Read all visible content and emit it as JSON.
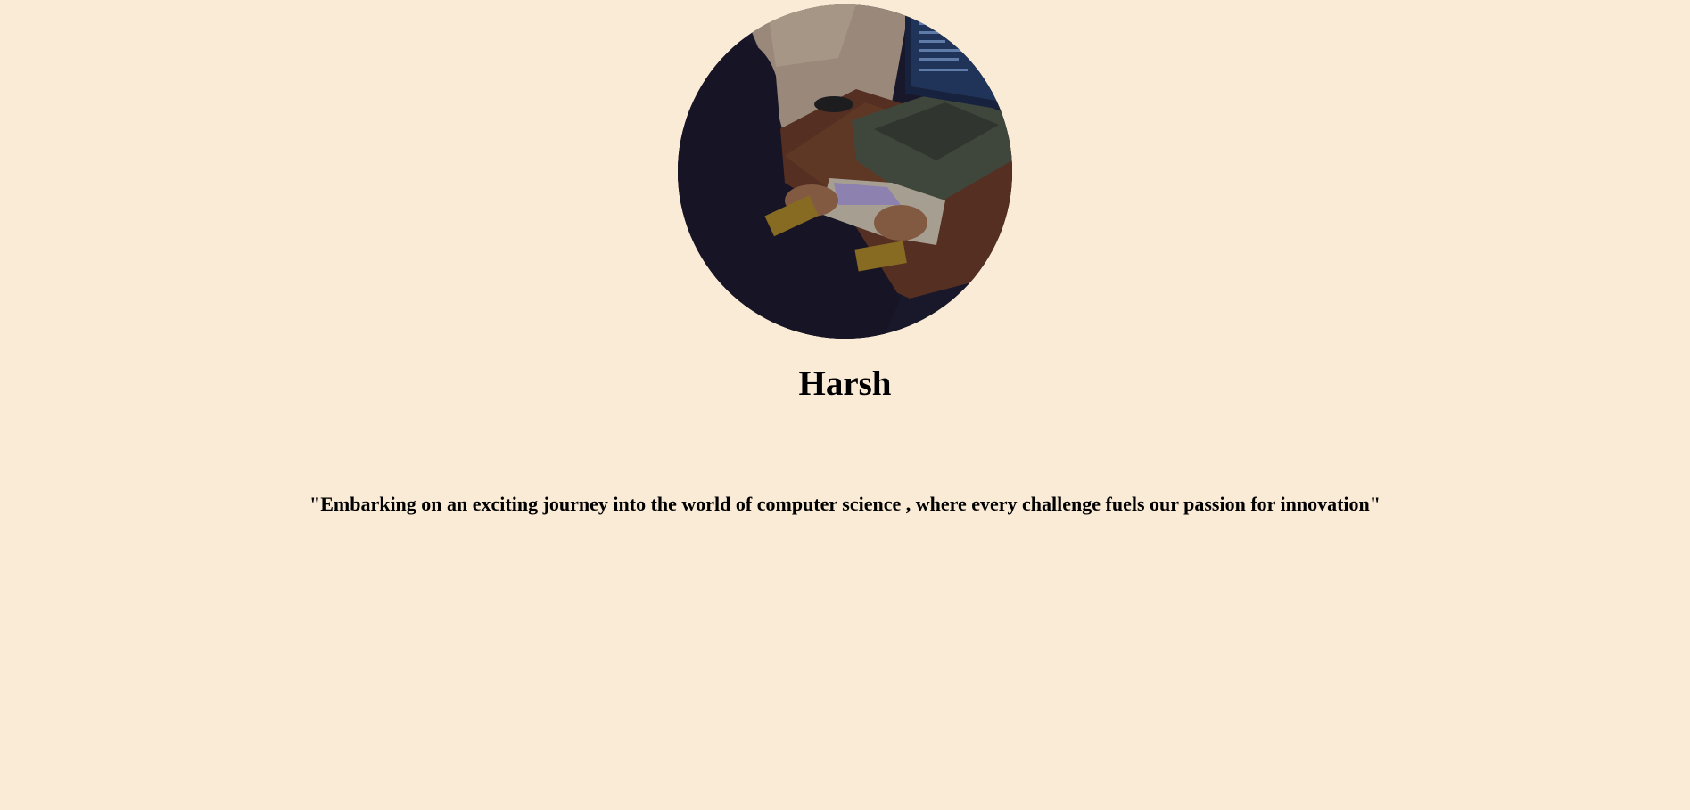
{
  "profile": {
    "photo_icon": "person-typing-on-keyboard-photo",
    "name": "Harsh",
    "quote": "\"Embarking on an exciting journey into the world of computer science , where every challenge fuels our passion for innovation\""
  },
  "colors": {
    "background": "#faebd7",
    "text": "#000000"
  }
}
